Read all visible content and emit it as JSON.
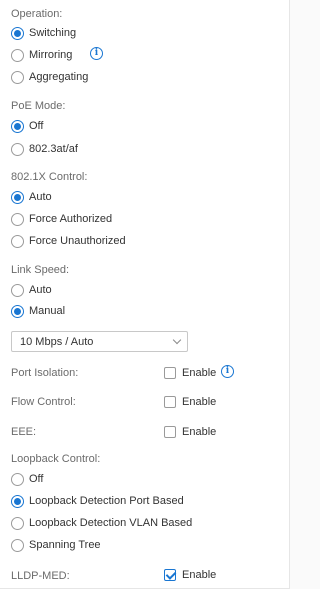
{
  "operation": {
    "label": "Operation:",
    "options": [
      "Switching",
      "Mirroring",
      "Aggregating"
    ],
    "selected": "Switching"
  },
  "poe_mode": {
    "label": "PoE Mode:",
    "options": [
      "Off",
      "802.3at/af"
    ],
    "selected": "Off"
  },
  "dot1x_control": {
    "label": "802.1X Control:",
    "options": [
      "Auto",
      "Force Authorized",
      "Force Unauthorized"
    ],
    "selected": "Auto"
  },
  "link_speed": {
    "label": "Link Speed:",
    "options": [
      "Auto",
      "Manual"
    ],
    "selected": "Manual",
    "dropdown_value": "10 Mbps / Auto"
  },
  "port_isolation": {
    "label": "Port Isolation:",
    "checkbox_label": "Enable",
    "checked": false
  },
  "flow_control": {
    "label": "Flow Control:",
    "checkbox_label": "Enable",
    "checked": false
  },
  "eee": {
    "label": "EEE:",
    "checkbox_label": "Enable",
    "checked": false
  },
  "loopback_control": {
    "label": "Loopback Control:",
    "options": [
      "Off",
      "Loopback Detection Port Based",
      "Loopback Detection VLAN Based",
      "Spanning Tree"
    ],
    "selected": "Loopback Detection Port Based"
  },
  "lldp_med": {
    "label": "LLDP-MED:",
    "checkbox_label": "Enable",
    "checked": true
  },
  "info_icon_glyph": "i",
  "accent_color": "#1976d2"
}
